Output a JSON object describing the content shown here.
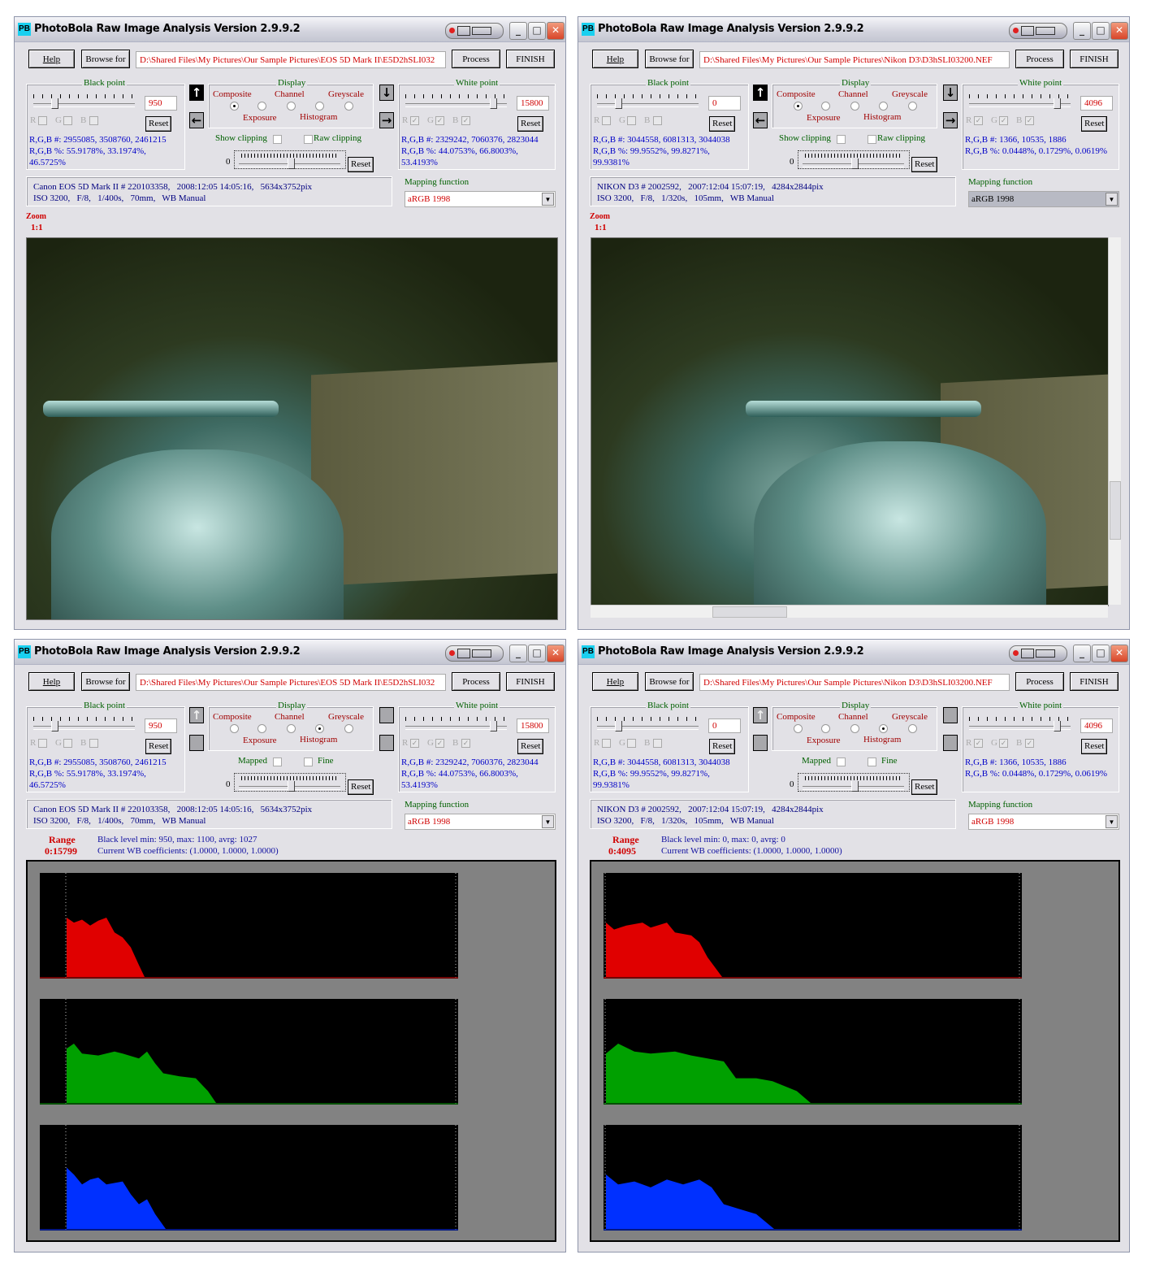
{
  "windows": [
    {
      "title": "PhotoBola Raw Image Analysis Version 2.9.9.2",
      "app_icon": "PB",
      "help": "Help",
      "browse": "Browse for",
      "path": "D:\\Shared Files\\My Pictures\\Our Sample Pictures\\EOS 5D Mark II\\E5D2hSLI032",
      "process": "Process",
      "finish": "FINISH",
      "black_point": {
        "label": "Black point",
        "value": "950",
        "r": "R",
        "g": "G",
        "b": "B",
        "checked": false,
        "reset": "Reset",
        "counts": "R,G,B  #: 2955085, 3508760, 2461215",
        "pct": "R,G,B %: 55.9178%, 33.1974%,",
        "pct2": "46.5725%"
      },
      "display": {
        "label": "Display",
        "composite": "Composite",
        "channel": "Channel",
        "greyscale": "Greyscale",
        "exposure": "Exposure",
        "histogram": "Histogram",
        "selected": "Composite"
      },
      "check1": "Show clipping",
      "check2": "Raw clipping",
      "slider_value": "0",
      "slider_reset": "Reset",
      "white_point": {
        "label": "White point",
        "value": "15800",
        "r": "R",
        "g": "G",
        "b": "B",
        "checked": true,
        "reset": "Reset",
        "counts": "R,G,B  #: 2329242, 7060376, 2823044",
        "pct": "R,G,B %: 44.0753%, 66.8003%,",
        "pct2": "53.4193%"
      },
      "info1": "Canon EOS 5D Mark II # 220103358,   2008:12:05 14:05:16,   5634x3752pix",
      "info2": "ISO 3200,   F/8,   1/400s,   70mm,   WB Manual",
      "mapping_label": "Mapping function",
      "mapping": "aRGB 1998",
      "zoom_label": "Zoom",
      "zoom": "1:1",
      "view": "image"
    },
    {
      "title": "PhotoBola Raw Image Analysis Version 2.9.9.2",
      "app_icon": "PB",
      "help": "Help",
      "browse": "Browse for",
      "path": "D:\\Shared Files\\My Pictures\\Our Sample Pictures\\Nikon D3\\D3hSLI03200.NEF",
      "process": "Process",
      "finish": "FINISH",
      "black_point": {
        "label": "Black point",
        "value": "0",
        "r": "R",
        "g": "G",
        "b": "B",
        "checked": false,
        "reset": "Reset",
        "counts": "R,G,B  #: 3044558, 6081313, 3044038",
        "pct": "R,G,B %: 99.9552%, 99.8271%,",
        "pct2": "99.9381%"
      },
      "display": {
        "label": "Display",
        "composite": "Composite",
        "channel": "Channel",
        "greyscale": "Greyscale",
        "exposure": "Exposure",
        "histogram": "Histogram",
        "selected": "Composite"
      },
      "check1": "Show clipping",
      "check2": "Raw clipping",
      "slider_value": "0",
      "slider_reset": "Reset",
      "white_point": {
        "label": "White point",
        "value": "4096",
        "r": "R",
        "g": "G",
        "b": "B",
        "checked": true,
        "reset": "Reset",
        "counts": "R,G,B  #: 1366, 10535, 1886",
        "pct": "R,G,B %: 0.0448%, 0.1729%, 0.0619%",
        "pct2": ""
      },
      "info1": "NIKON D3 # 2002592,   2007:12:04 15:07:19,   4284x2844pix",
      "info2": "ISO 3200,   F/8,   1/320s,   105mm,   WB Manual",
      "mapping_label": "Mapping function",
      "mapping": "aRGB 1998",
      "mapping_focused": true,
      "zoom_label": "Zoom",
      "zoom": "1:1",
      "view": "image-scroll"
    },
    {
      "title": "PhotoBola Raw Image Analysis Version 2.9.9.2",
      "app_icon": "PB",
      "help": "Help",
      "browse": "Browse for",
      "path": "D:\\Shared Files\\My Pictures\\Our Sample Pictures\\EOS 5D Mark II\\E5D2hSLI032",
      "process": "Process",
      "finish": "FINISH",
      "black_point": {
        "label": "Black point",
        "value": "950",
        "r": "R",
        "g": "G",
        "b": "B",
        "checked": false,
        "reset": "Reset",
        "counts": "R,G,B  #: 2955085, 3508760, 2461215",
        "pct": "R,G,B %: 55.9178%, 33.1974%,",
        "pct2": "46.5725%"
      },
      "display": {
        "label": "Display",
        "composite": "Composite",
        "channel": "Channel",
        "greyscale": "Greyscale",
        "exposure": "Exposure",
        "histogram": "Histogram",
        "selected": "Histogram"
      },
      "check1": "Mapped",
      "check2": "Fine",
      "slider_value": "0",
      "slider_reset": "Reset",
      "white_point": {
        "label": "White point",
        "value": "15800",
        "r": "R",
        "g": "G",
        "b": "B",
        "checked": true,
        "reset": "Reset",
        "counts": "R,G,B  #: 2329242, 7060376, 2823044",
        "pct": "R,G,B %: 44.0753%, 66.8003%,",
        "pct2": "53.4193%"
      },
      "info1": "Canon EOS 5D Mark II # 220103358,   2008:12:05 14:05:16,   5634x3752pix",
      "info2": "ISO 3200,   F/8,   1/400s,   70mm,   WB Manual",
      "mapping_label": "Mapping function",
      "mapping": "aRGB 1998",
      "range_label": "Range",
      "range": "0:15799",
      "black_level": "Black level min: 950, max: 1100, avrg: 1027",
      "wb_coeffs": "Current WB coefficients: (1.0000, 1.0000, 1.0000)",
      "view": "histogram",
      "chart_index": 0
    },
    {
      "title": "PhotoBola Raw Image Analysis Version 2.9.9.2",
      "app_icon": "PB",
      "help": "Help",
      "browse": "Browse for",
      "path": "D:\\Shared Files\\My Pictures\\Our Sample Pictures\\Nikon D3\\D3hSLI03200.NEF",
      "process": "Process",
      "finish": "FINISH",
      "black_point": {
        "label": "Black point",
        "value": "0",
        "r": "R",
        "g": "G",
        "b": "B",
        "checked": false,
        "reset": "Reset",
        "counts": "R,G,B  #: 3044558, 6081313, 3044038",
        "pct": "R,G,B %: 99.9552%, 99.8271%,",
        "pct2": "99.9381%"
      },
      "display": {
        "label": "Display",
        "composite": "Composite",
        "channel": "Channel",
        "greyscale": "Greyscale",
        "exposure": "Exposure",
        "histogram": "Histogram",
        "selected": "Histogram"
      },
      "check1": "Mapped",
      "check2": "Fine",
      "slider_value": "0",
      "slider_reset": "Reset",
      "white_point": {
        "label": "White point",
        "value": "4096",
        "r": "R",
        "g": "G",
        "b": "B",
        "checked": true,
        "reset": "Reset",
        "counts": "R,G,B  #: 1366, 10535, 1886",
        "pct": "R,G,B %: 0.0448%, 0.1729%, 0.0619%",
        "pct2": ""
      },
      "info1": "NIKON D3 # 2002592,   2007:12:04 15:07:19,   4284x2844pix",
      "info2": "ISO 3200,   F/8,   1/320s,   105mm,   WB Manual",
      "mapping_label": "Mapping function",
      "mapping": "aRGB 1998",
      "range_label": "Range",
      "range": "0:4095",
      "black_level": "Black level min: 0, max: 0, avrg: 0",
      "wb_coeffs": "Current WB coefficients: (1.0000, 1.0000, 1.0000)",
      "view": "histogram",
      "chart_index": 1
    }
  ],
  "chart_data": [
    {
      "type": "area",
      "xlim": [
        0,
        15799
      ],
      "series": [
        {
          "color": "#e00000",
          "points": [
            [
              1012,
              0.6
            ],
            [
              1289,
              0.55
            ],
            [
              1595,
              0.58
            ],
            [
              1902,
              0.52
            ],
            [
              2209,
              0.57
            ],
            [
              2516,
              0.6
            ],
            [
              2822,
              0.45
            ],
            [
              3129,
              0.4
            ],
            [
              3436,
              0.3
            ],
            [
              3743,
              0.12
            ],
            [
              3957,
              0
            ]
          ]
        },
        {
          "color": "#00a000",
          "points": [
            [
              1012,
              0.55
            ],
            [
              1289,
              0.6
            ],
            [
              1595,
              0.5
            ],
            [
              2209,
              0.48
            ],
            [
              2822,
              0.52
            ],
            [
              3129,
              0.5
            ],
            [
              3743,
              0.45
            ],
            [
              4050,
              0.52
            ],
            [
              4356,
              0.4
            ],
            [
              4663,
              0.3
            ],
            [
              5277,
              0.27
            ],
            [
              5890,
              0.25
            ],
            [
              6351,
              0.12
            ],
            [
              6657,
              0
            ]
          ]
        },
        {
          "color": "#0030ff",
          "points": [
            [
              1012,
              0.62
            ],
            [
              1289,
              0.55
            ],
            [
              1595,
              0.45
            ],
            [
              1902,
              0.5
            ],
            [
              2209,
              0.52
            ],
            [
              2516,
              0.45
            ],
            [
              3129,
              0.48
            ],
            [
              3436,
              0.35
            ],
            [
              3743,
              0.25
            ],
            [
              4050,
              0.3
            ],
            [
              4356,
              0.15
            ],
            [
              4755,
              0
            ]
          ]
        }
      ]
    },
    {
      "type": "area",
      "xlim": [
        0,
        4095
      ],
      "series": [
        {
          "color": "#e00000",
          "points": [
            [
              24,
              0.55
            ],
            [
              103,
              0.48
            ],
            [
              223,
              0.52
            ],
            [
              382,
              0.55
            ],
            [
              461,
              0.5
            ],
            [
              620,
              0.55
            ],
            [
              700,
              0.45
            ],
            [
              859,
              0.42
            ],
            [
              938,
              0.35
            ],
            [
              1018,
              0.2
            ],
            [
              1161,
              0
            ]
          ]
        },
        {
          "color": "#00a000",
          "points": [
            [
              24,
              0.5
            ],
            [
              143,
              0.6
            ],
            [
              302,
              0.52
            ],
            [
              461,
              0.5
            ],
            [
              700,
              0.52
            ],
            [
              859,
              0.48
            ],
            [
              1018,
              0.45
            ],
            [
              1177,
              0.42
            ],
            [
              1296,
              0.25
            ],
            [
              1495,
              0.25
            ],
            [
              1654,
              0.22
            ],
            [
              1892,
              0.12
            ],
            [
              2028,
              0
            ]
          ]
        },
        {
          "color": "#0030ff",
          "points": [
            [
              24,
              0.55
            ],
            [
              143,
              0.45
            ],
            [
              302,
              0.48
            ],
            [
              461,
              0.42
            ],
            [
              620,
              0.5
            ],
            [
              779,
              0.45
            ],
            [
              938,
              0.5
            ],
            [
              1058,
              0.42
            ],
            [
              1177,
              0.25
            ],
            [
              1336,
              0.2
            ],
            [
              1495,
              0.15
            ],
            [
              1670,
              0
            ]
          ]
        }
      ]
    }
  ]
}
